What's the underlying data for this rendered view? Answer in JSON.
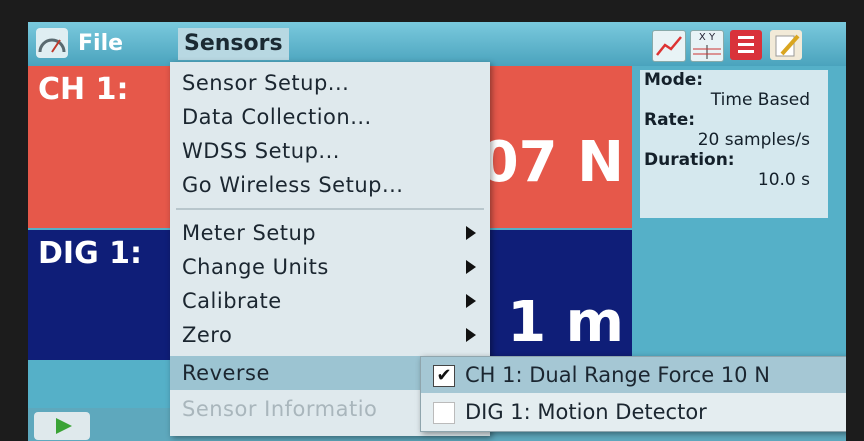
{
  "menubar": {
    "file_label": "File",
    "sensors_label": "Sensors",
    "app_icon": "gauge-icon"
  },
  "toolbar": {
    "icons": [
      "graph-icon",
      "table-icon",
      "meter-icon",
      "notes-icon"
    ],
    "table_icon_text": "X Y"
  },
  "panels": {
    "ch1_label": "CH 1:",
    "ch1_value": "07 N",
    "dig1_label": "DIG 1:",
    "dig1_value": "1 m"
  },
  "info": {
    "mode_label": "Mode:",
    "mode_value": "Time Based",
    "rate_label": "Rate:",
    "rate_value": "20 samples/s",
    "duration_label": "Duration:",
    "duration_value": "10.0 s"
  },
  "sensors_menu": {
    "items": [
      {
        "label": "Sensor Setup..."
      },
      {
        "label": "Data Collection..."
      },
      {
        "label": "WDSS Setup..."
      },
      {
        "label": "Go Wireless Setup..."
      },
      {
        "label": "Meter Setup"
      },
      {
        "label": "Change Units"
      },
      {
        "label": "Calibrate"
      },
      {
        "label": "Zero"
      },
      {
        "label": "Reverse"
      },
      {
        "label": "Sensor Informatio"
      }
    ]
  },
  "reverse_submenu": {
    "items": [
      {
        "label": "CH 1: Dual Range Force 10 N",
        "checked": true
      },
      {
        "label": "DIG 1: Motion Detector",
        "checked": false
      }
    ],
    "checkmark": "✔"
  },
  "colors": {
    "ch1_panel": "#e6584a",
    "dig1_panel": "#0f1e78",
    "background": "#55b0c8",
    "menu_highlight": "#9cc4d2"
  }
}
